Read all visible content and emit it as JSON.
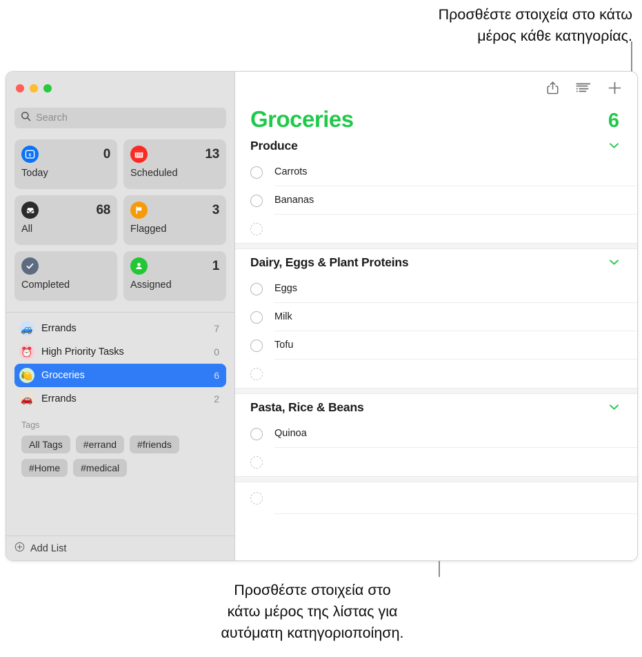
{
  "callouts": {
    "top": "Προσθέστε στοιχεία στο κάτω\nμέρος κάθε κατηγορίας.",
    "bottom": "Προσθέστε στοιχεία στο\nκάτω μέρος της λίστας για\nαυτόματη κατηγοριοποίηση."
  },
  "colors": {
    "accent_green": "#20c94b",
    "selection_blue": "#2f7cf6",
    "sidebar_bg": "#e3e3e3",
    "card_bg": "#d2d2d2"
  },
  "window": {
    "traffic_lights": [
      "close",
      "minimize",
      "zoom"
    ]
  },
  "sidebar": {
    "search": {
      "placeholder": "Search",
      "value": "",
      "icon": "search-icon"
    },
    "smart_lists": [
      {
        "label": "Today",
        "count": "0",
        "icon": "calendar-day-icon",
        "icon_color": "#0a72f5"
      },
      {
        "label": "Scheduled",
        "count": "13",
        "icon": "calendar-icon",
        "icon_color": "#fa2a23"
      },
      {
        "label": "All",
        "count": "68",
        "icon": "tray-icon",
        "icon_color": "#2b2b2b"
      },
      {
        "label": "Flagged",
        "count": "3",
        "icon": "flag-icon",
        "icon_color": "#f59b0b"
      },
      {
        "label": "Completed",
        "count": "",
        "icon": "checkmark-icon",
        "icon_color": "#5c6b7f"
      },
      {
        "label": "Assigned",
        "count": "1",
        "icon": "person-icon",
        "icon_color": "#23c635"
      }
    ],
    "lists": [
      {
        "name": "Errands",
        "count": "7",
        "emoji": "🚙",
        "bg": "#cfe1f9",
        "selected": false
      },
      {
        "name": "High Priority Tasks",
        "count": "0",
        "emoji": "⏰",
        "bg": "#f9ccd8",
        "selected": false
      },
      {
        "name": "Groceries",
        "count": "6",
        "emoji": "🍋",
        "bg": "#d5f3d2",
        "selected": true
      },
      {
        "name": "Errands",
        "count": "2",
        "emoji": "🚗",
        "bg": "#ece2d2",
        "selected": false
      }
    ],
    "tags_title": "Tags",
    "tags": [
      "All Tags",
      "#errand",
      "#friends",
      "#Home",
      "#medical"
    ],
    "add_list_label": "Add List",
    "add_list_icon": "plus-circle-icon"
  },
  "main": {
    "toolbar": [
      {
        "name": "share-icon",
        "label": "Share"
      },
      {
        "name": "list-options-icon",
        "label": "List Options"
      },
      {
        "name": "add-reminder-icon",
        "label": "Add Reminder"
      }
    ],
    "title": "Groceries",
    "total": "6",
    "sections": [
      {
        "title": "Produce",
        "items": [
          "Carrots",
          "Bananas"
        ],
        "has_new_row": true
      },
      {
        "title": "Dairy, Eggs & Plant Proteins",
        "items": [
          "Eggs",
          "Milk",
          "Tofu"
        ],
        "has_new_row": true
      },
      {
        "title": "Pasta, Rice & Beans",
        "items": [
          "Quinoa"
        ],
        "has_new_row": true
      }
    ],
    "list_new_row": true
  }
}
